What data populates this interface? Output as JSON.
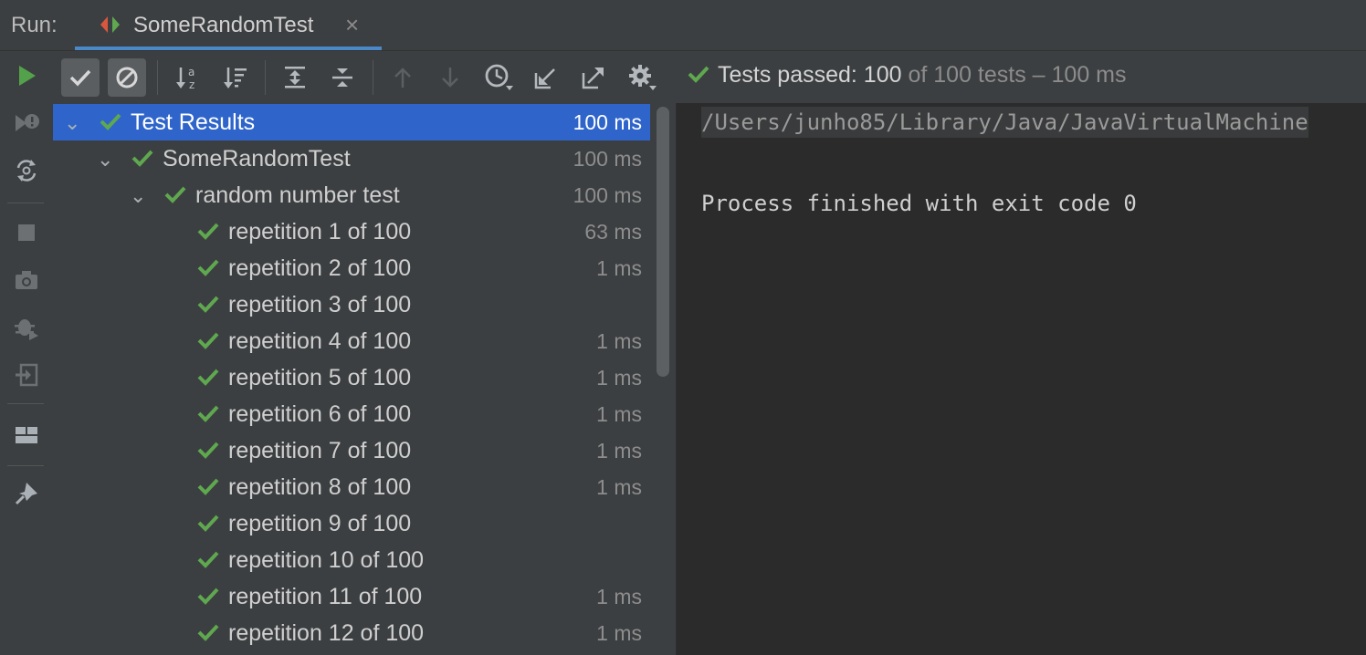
{
  "run_tab": {
    "run_label": "Run:",
    "title": "SomeRandomTest",
    "close_glyph": "×"
  },
  "status": {
    "passed_label": "Tests passed: 100",
    "rest": " of 100 tests – 100 ms"
  },
  "tree": {
    "root": {
      "label": "Test Results",
      "duration": "100 ms"
    },
    "class_node": {
      "label": "SomeRandomTest",
      "duration": "100 ms"
    },
    "method_node": {
      "label": "random number test",
      "duration": "100 ms"
    },
    "items": [
      {
        "label": "repetition 1 of 100",
        "duration": "63 ms"
      },
      {
        "label": "repetition 2 of 100",
        "duration": "1 ms"
      },
      {
        "label": "repetition 3 of 100",
        "duration": ""
      },
      {
        "label": "repetition 4 of 100",
        "duration": "1 ms"
      },
      {
        "label": "repetition 5 of 100",
        "duration": "1 ms"
      },
      {
        "label": "repetition 6 of 100",
        "duration": "1 ms"
      },
      {
        "label": "repetition 7 of 100",
        "duration": "1 ms"
      },
      {
        "label": "repetition 8 of 100",
        "duration": "1 ms"
      },
      {
        "label": "repetition 9 of 100",
        "duration": ""
      },
      {
        "label": "repetition 10 of 100",
        "duration": ""
      },
      {
        "label": "repetition 11 of 100",
        "duration": "1 ms"
      },
      {
        "label": "repetition 12 of 100",
        "duration": "1 ms"
      }
    ]
  },
  "console": {
    "command_line": "/Users/junho85/Library/Java/JavaVirtualMachine",
    "finished_line": "Process finished with exit code 0"
  },
  "colors": {
    "pass_green": "#5fa84f",
    "selection_blue": "#2f65ca",
    "tab_underline": "#4a88c7"
  },
  "icons": {
    "left_toolbar": [
      "run-icon",
      "rerun-failed-icon",
      "toggle-auto-test-icon",
      "stop-icon",
      "screenshot-icon",
      "debug-icon",
      "exit-icon",
      "layout-icon",
      "pin-icon"
    ],
    "top_toolbar": [
      "show-passed-icon",
      "show-ignored-icon",
      "sort-alphabetically-icon",
      "sort-by-duration-icon",
      "expand-all-icon",
      "collapse-all-icon",
      "previous-failed-icon",
      "next-failed-icon",
      "history-icon",
      "import-tests-icon",
      "export-tests-icon",
      "settings-icon"
    ]
  }
}
